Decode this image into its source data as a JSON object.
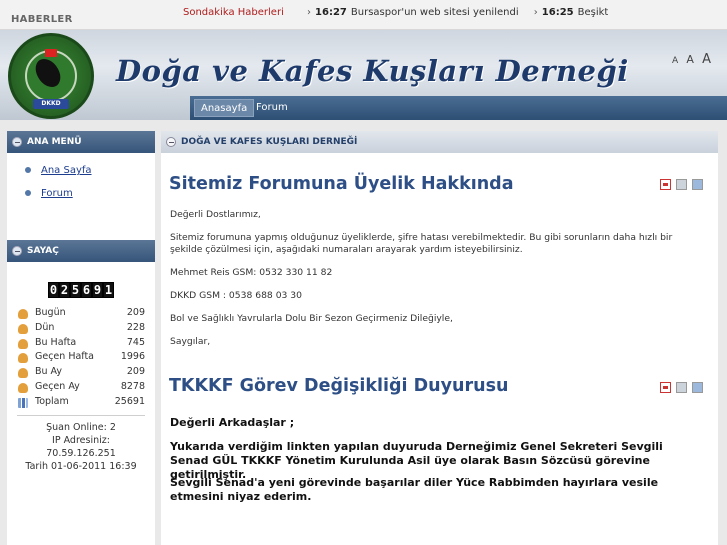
{
  "ticker": {
    "label": "HABERLER",
    "breaking": "Sondakika Haberleri",
    "items": [
      {
        "arrow": "›",
        "time": "16:27",
        "text": "Bursaspor'un web sitesi yenilendi"
      },
      {
        "arrow": "›",
        "time": "16:25",
        "text": "Beşiktaş futbol"
      }
    ]
  },
  "header": {
    "title": "Doğa ve Kafes Kuşları Derneği",
    "logo_ring_text": "DOĞA VE KAFES KUŞLARI DERNEĞİ",
    "logo_year": "2006",
    "logo_badge": "DKKD",
    "font_sizes": [
      "A",
      "A",
      "A"
    ]
  },
  "nav": {
    "items": [
      {
        "label": "Anasayfa"
      },
      {
        "label": "Forum"
      }
    ]
  },
  "sidebar": {
    "menu_title": "ANA MENÜ",
    "menu_items": [
      {
        "label": "Ana Sayfa"
      },
      {
        "label": "Forum"
      }
    ],
    "counter_title": "SAYAÇ",
    "counter_digits": [
      "0",
      "2",
      "5",
      "6",
      "9",
      "1"
    ],
    "stats": [
      {
        "label": "Bugün",
        "value": "209",
        "icon": "user-icon"
      },
      {
        "label": "Dün",
        "value": "228",
        "icon": "user-icon"
      },
      {
        "label": "Bu Hafta",
        "value": "745",
        "icon": "user-icon"
      },
      {
        "label": "Geçen Hafta",
        "value": "1996",
        "icon": "user-icon"
      },
      {
        "label": "Bu Ay",
        "value": "209",
        "icon": "user-icon"
      },
      {
        "label": "Geçen Ay",
        "value": "8278",
        "icon": "user-icon"
      },
      {
        "label": "Toplam",
        "value": "25691",
        "icon": "chart-icon"
      }
    ],
    "online": "Şuan Online: 2",
    "ip_label": "IP Adresiniz:",
    "ip": "70.59.126.251",
    "date": "Tarih 01-06-2011 16:39"
  },
  "main": {
    "section_title": "DOĞA VE KAFES KUŞLARI DERNEĞİ",
    "article1": {
      "title": "Sitemiz Forumuna Üyelik Hakkında",
      "paragraphs": [
        "Değerli Dostlarımız,",
        "Sitemiz forumuna yapmış olduğunuz üyeliklerde, şifre hatası verebilmektedir. Bu gibi sorunların daha hızlı bir şekilde çözülmesi için, aşağıdaki numaraları arayarak yardım isteyebilirsiniz.",
        "Mehmet Reis GSM: 0532 330 11 82",
        "DKKD GSM : 0538 688 03 30",
        "Bol ve Sağlıklı Yavrularla Dolu Bir Sezon Geçirmeniz Dileğiyle,",
        "Saygılar,"
      ]
    },
    "article2": {
      "title": "TKKKF Görev Değişikliği Duyurusu",
      "paragraphs": [
        "Değerli Arkadaşlar ;",
        "Yukarıda verdiğim linkten yapılan duyuruda Derneğimiz Genel Sekreteri Sevgili Senad GÜL TKKKF Yönetim Kurulunda Asil üye olarak Basın Sözcüsü görevine getirilmiştir.",
        "Sevgili Senad'a yeni görevinde başarılar diler Yüce Rabbimden hayırlara vesile etmesini niyaz ederim."
      ]
    }
  },
  "colors": {
    "accent": "#2d4f85",
    "nav": "#36557a",
    "breaking": "#b01c1c"
  }
}
